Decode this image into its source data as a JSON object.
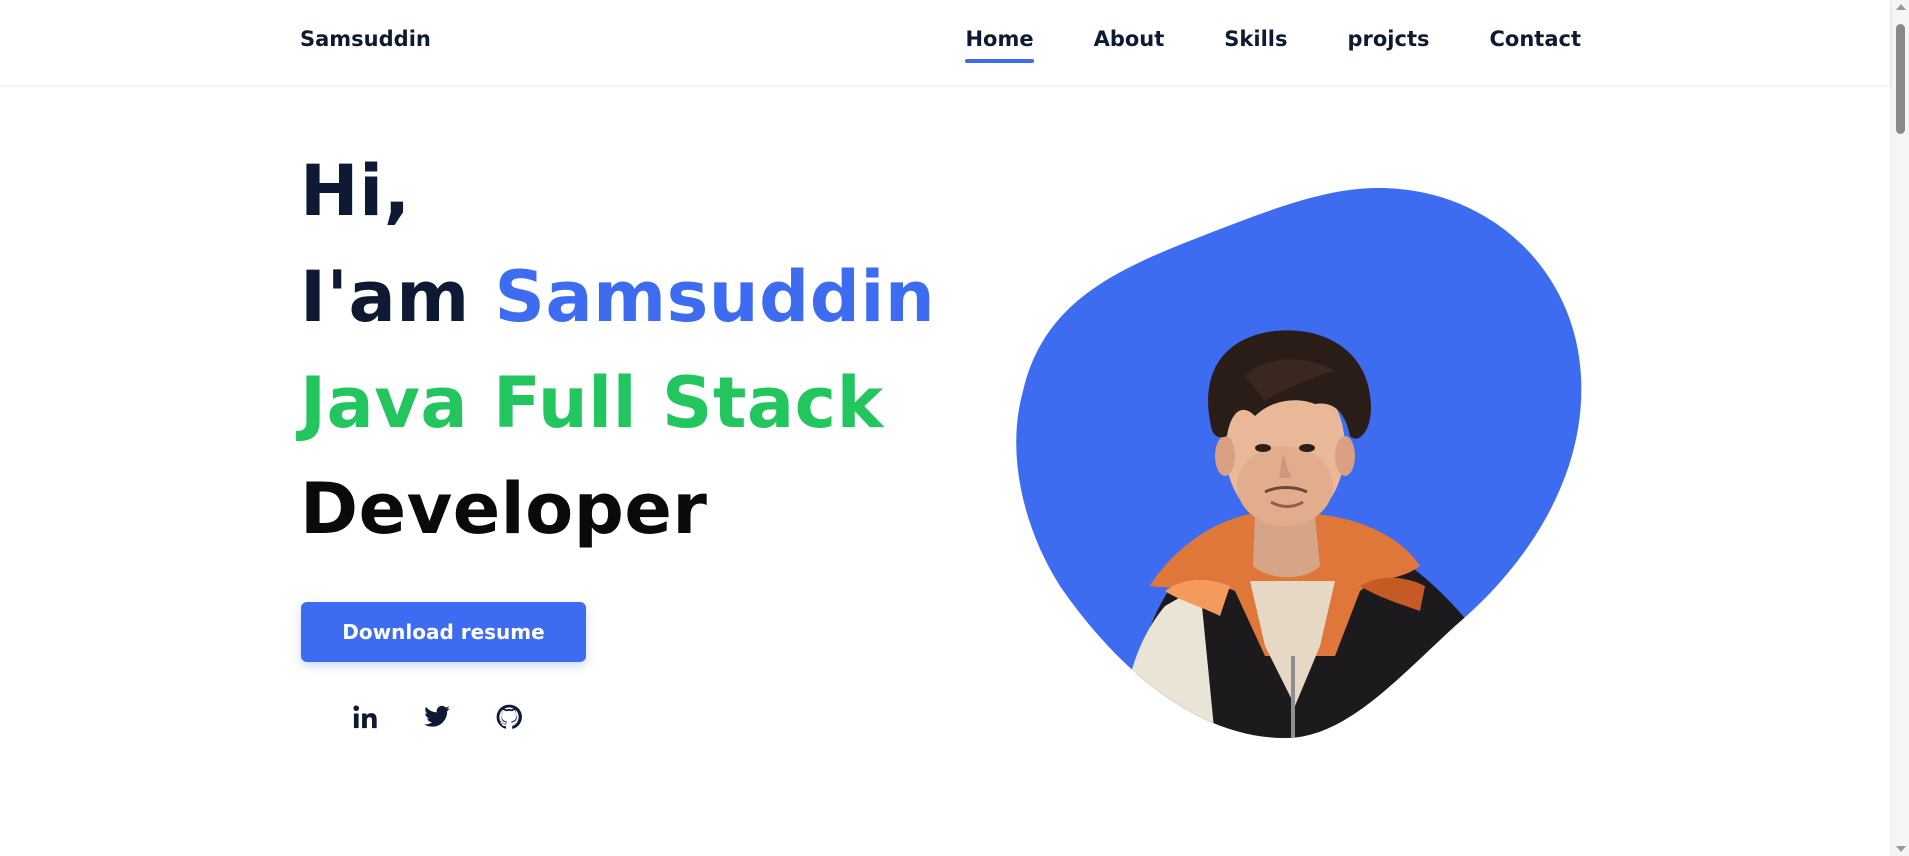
{
  "brand": {
    "name": "Samsuddin"
  },
  "nav": {
    "items": [
      {
        "label": "Home",
        "active": true
      },
      {
        "label": "About"
      },
      {
        "label": "Skills"
      },
      {
        "label": "projcts"
      },
      {
        "label": "Contact"
      }
    ]
  },
  "hero": {
    "greeting": "Hi,",
    "intro_prefix": "I'am",
    "name": "Samsuddin",
    "role_highlight": "Java Full Stack",
    "role_rest": "Developer",
    "download_label": "Download resume"
  },
  "socials": [
    {
      "icon": "linkedin-icon"
    },
    {
      "icon": "twitter-icon"
    },
    {
      "icon": "github-icon"
    }
  ],
  "colors": {
    "accent_blue": "#3d6cf0",
    "accent_green": "#22c55e",
    "text_dark": "#0e1a33"
  }
}
